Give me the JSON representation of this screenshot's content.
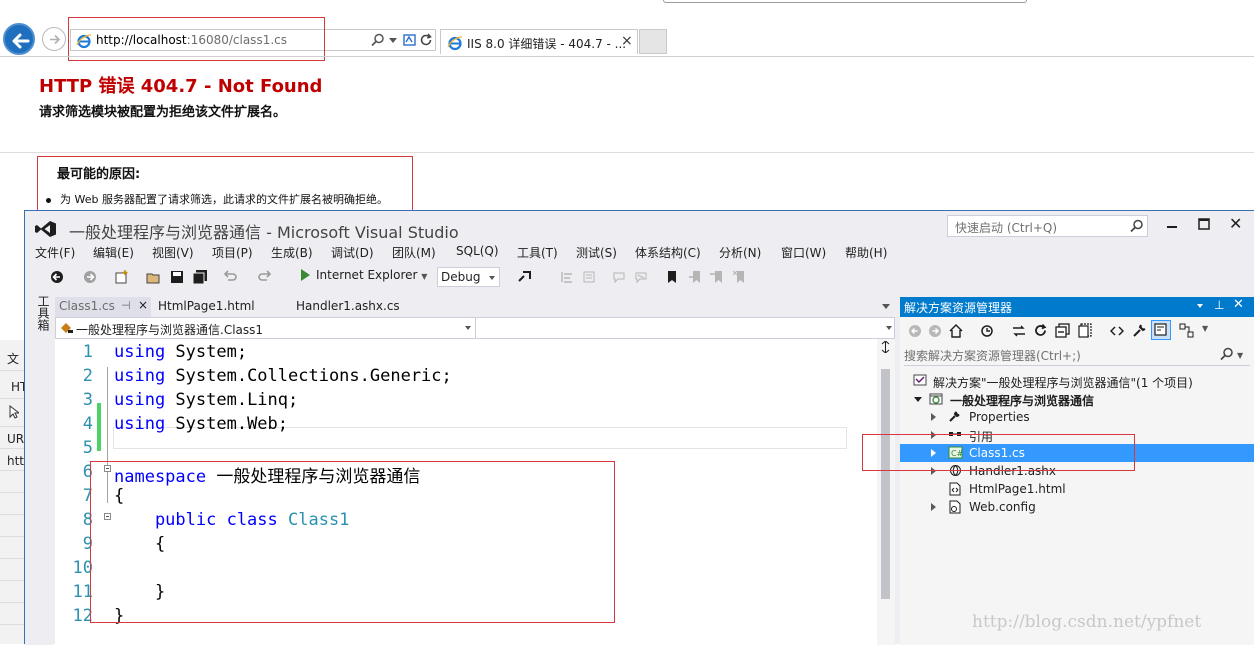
{
  "browser": {
    "url_host": "http://localhost",
    "url_rest": ":16080/class1.cs",
    "tab_title": "IIS 8.0 详细错误 - 404.7 - ...",
    "tab_close": "×",
    "error_title": "HTTP 错误  404.7 - Not Found",
    "error_sub": "请求筛选模块被配置为拒绝该文件扩展名。",
    "cause_title": "最可能的原因:",
    "cause_item": "为 Web 服务器配置了请求筛选，此请求的文件扩展名被明确拒绝。",
    "side_strip": [
      "文",
      "HT",
      "UR",
      "htt"
    ]
  },
  "vs": {
    "title": "一般处理程序与浏览器通信 - Microsoft Visual Studio",
    "quick_launch_placeholder": "快速启动 (Ctrl+Q)",
    "menu": [
      "文件(F)",
      "编辑(E)",
      "视图(V)",
      "项目(P)",
      "生成(B)",
      "调试(D)",
      "团队(M)",
      "SQL(Q)",
      "工具(T)",
      "测试(S)",
      "体系结构(C)",
      "分析(N)",
      "窗口(W)",
      "帮助(H)"
    ],
    "run_target": "Internet Explorer",
    "configuration": "Debug",
    "toolbox_label": "工具箱",
    "doc_tabs": [
      "Class1.cs",
      "HtmlPage1.html",
      "Handler1.ashx.cs"
    ],
    "doc_tab_pin": "⊣",
    "doc_tab_close": "×",
    "nav_left": "一般处理程序与浏览器通信.Class1",
    "line_numbers": [
      "1",
      "2",
      "3",
      "4",
      "5",
      "6",
      "7",
      "8",
      "9",
      "10",
      "11",
      "12"
    ],
    "code": {
      "l1_kw": "using",
      "l1_rest": " System;",
      "l2_kw": "using",
      "l2_rest": " System.Collections.Generic;",
      "l3_kw": "using",
      "l3_rest": " System.Linq;",
      "l4_kw": "using",
      "l4_rest": " System.Web;",
      "l6_kw": "namespace",
      "l6_rest": " 一般处理程序与浏览器通信",
      "l7": "{",
      "l8_kw": "    public class",
      "l8_type": " Class1",
      "l9": "    {",
      "l11": "    }",
      "l12": "}"
    }
  },
  "solution_explorer": {
    "title": "解决方案资源管理器",
    "search_placeholder": "搜索解决方案资源管理器(Ctrl+;)",
    "items": [
      {
        "label": "解决方案\"一般处理程序与浏览器通信\"(1 个项目)"
      },
      {
        "label": "一般处理程序与浏览器通信"
      },
      {
        "label": "Properties"
      },
      {
        "label": "引用"
      },
      {
        "label": "Class1.cs"
      },
      {
        "label": "Handler1.ashx"
      },
      {
        "label": "HtmlPage1.html"
      },
      {
        "label": "Web.config"
      }
    ]
  },
  "watermark": "http://blog.csdn.net/ypfnet",
  "colors": {
    "accent": "#007acc",
    "error_red": "#c00000",
    "highlight_box": "#d6393d",
    "selection": "#3399ff"
  }
}
